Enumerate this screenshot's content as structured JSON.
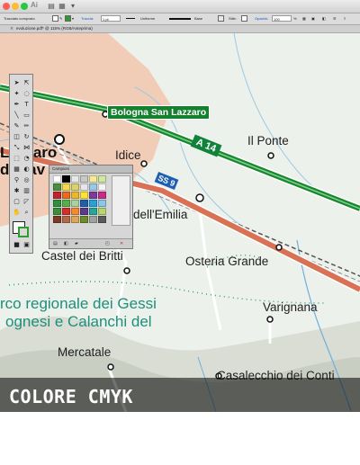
{
  "window": {
    "app_logo": "Ai"
  },
  "control_bar": {
    "selection": "Tracciato composto",
    "stroke_label": "Traccia:",
    "stroke_weight": "1 pt",
    "profile": "Uniforme",
    "brush": "Base",
    "style_label": "Stile:",
    "opacity_label": "Opacità:",
    "opacity_value": "100",
    "opacity_unit": "%"
  },
  "document": {
    "tab_title": "evoluzione.pdf* @ 115% (RGB/Anteprima)"
  },
  "map": {
    "sign": "Bologna San Lazzaro",
    "motorway_shield": "A 14",
    "road_shield": "SS 9",
    "towns": {
      "lazzaro": "Lazzaro",
      "di_savena": "di Sav",
      "il_ponte": "Il Ponte",
      "idice": "Idice",
      "emilia": "dell'Emilia",
      "castel_dei_britti": "Castel dei Britti",
      "osteria_grande": "Osteria Grande",
      "varignana": "Varignana",
      "mercatale": "Mercatale",
      "casalecchio": "Casalecchio dei Conti"
    },
    "park": {
      "line1": "rco regionale dei Gessi",
      "line2": "ognesi e Calanchi del"
    }
  },
  "swatches_panel": {
    "title": "Campioni",
    "colors": [
      "#ffffff",
      "#000000",
      "#e8e8e8",
      "#c8c8c8",
      "#f2ea98",
      "#d1e8a0",
      "#4a8f3c",
      "#f6d84a",
      "#d9d36f",
      "#e6e6e6",
      "#9cc8e8",
      "#f4f4f4",
      "#c32228",
      "#e86b1f",
      "#ecb72d",
      "#ffe234",
      "#7a3d98",
      "#c82b8c",
      "#2f8f3d",
      "#55b04a",
      "#a8d29f",
      "#1f5fa8",
      "#2aa0d8",
      "#8cc7e8",
      "#3c8c3a",
      "#d62e2e",
      "#f28b2c",
      "#5a3a8c",
      "#26a69a",
      "#b5d66c",
      "#7c3a22",
      "#b2684a",
      "#d9a65a",
      "#6c8c2a",
      "#a0a0a0",
      "#5a5a5a"
    ]
  },
  "caption": {
    "text": "COLORE CMYK"
  },
  "colors": {
    "motorway": "#16862e",
    "main_road": "#d46b4c",
    "park_text": "#1d8f7b",
    "urban": "#f0ccb5"
  }
}
